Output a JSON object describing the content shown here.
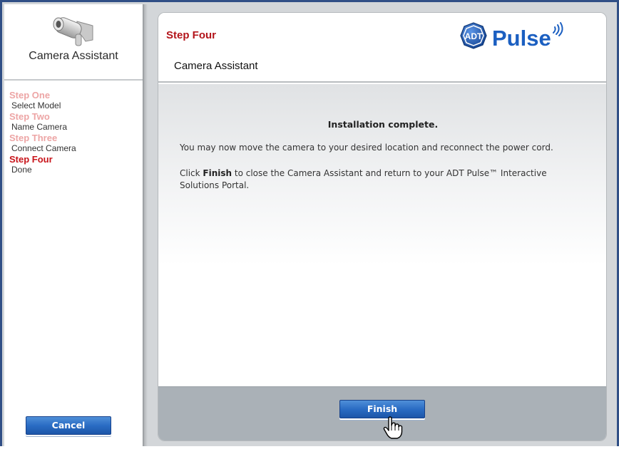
{
  "sidebar": {
    "title": "Camera Assistant",
    "steps": [
      {
        "title": "Step One",
        "subtitle": "Select Model",
        "active": false
      },
      {
        "title": "Step Two",
        "subtitle": "Name Camera",
        "active": false
      },
      {
        "title": "Step Three",
        "subtitle": "Connect Camera",
        "active": false
      },
      {
        "title": "Step Four",
        "subtitle": "Done",
        "active": true
      }
    ],
    "cancel_label": "Cancel"
  },
  "panel": {
    "step_heading": "Step Four",
    "title": "Camera Assistant",
    "logo": {
      "badge_text": "ADT",
      "brand_text": "Pulse"
    },
    "body": {
      "heading": "Installation complete.",
      "message1": "You may now move the camera to your desired location and reconnect the power cord.",
      "message2_prefix": "Click ",
      "message2_bold": "Finish",
      "message2_suffix": " to close the Camera Assistant and return to your ADT Pulse™ Interactive Solutions Portal."
    },
    "finish_label": "Finish"
  },
  "colors": {
    "frame_border": "#304f86",
    "active_step": "#c8141a",
    "inactive_step": "#eda5a5",
    "button_blue": "#2a6cc4",
    "adt_blue": "#1b5fc1"
  },
  "icons": [
    "security-camera-icon",
    "hand-pointer-icon",
    "wifi-signal-icon"
  ]
}
